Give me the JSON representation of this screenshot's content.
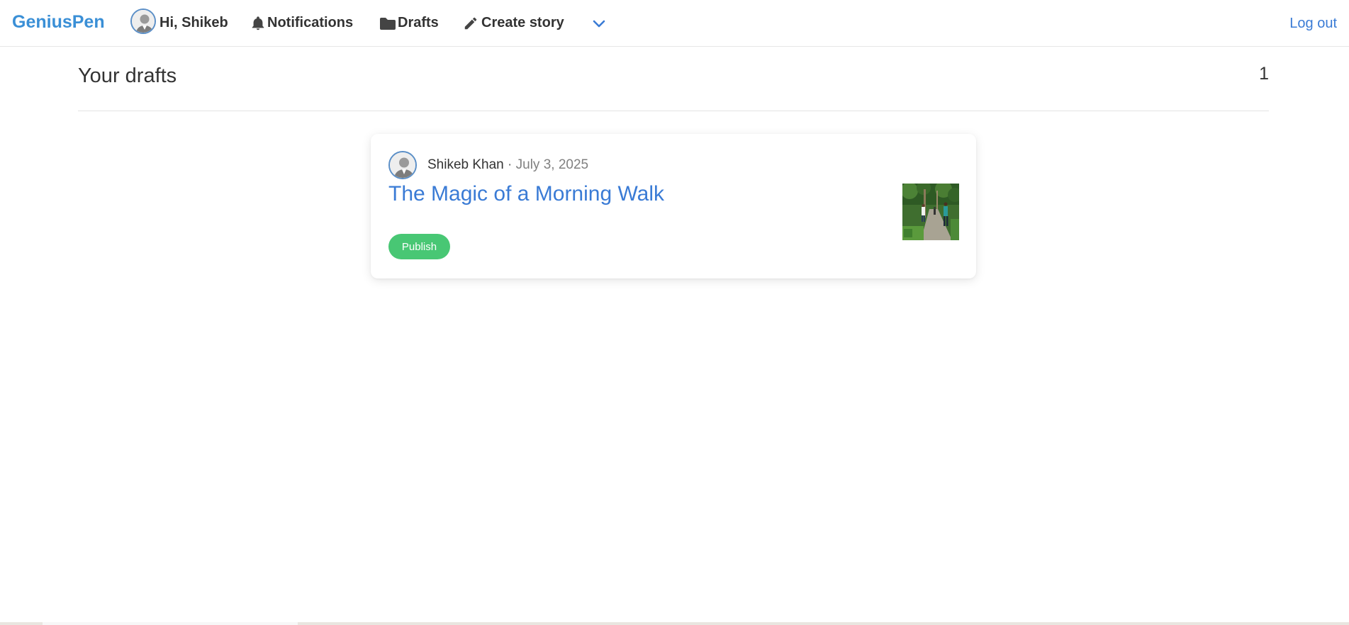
{
  "navbar": {
    "brand": "GeniusPen",
    "greeting": "Hi, Shikeb",
    "notifications_label": "Notifications",
    "drafts_label": "Drafts",
    "create_story_label": "Create story",
    "logout_label": "Log out",
    "icons": {
      "avatar": "user-avatar-icon",
      "notifications": "bell-icon",
      "drafts": "folder-icon",
      "create_story": "pencil-icon",
      "menu": "chevron-down-icon"
    }
  },
  "page": {
    "title": "Your drafts",
    "count": "1"
  },
  "drafts": [
    {
      "author": "Shikeb Khan",
      "separator": "·",
      "date": "July 3, 2025",
      "title": "The Magic of a Morning Walk",
      "publish_label": "Publish"
    }
  ],
  "colors": {
    "brand": "#3a8fd6",
    "link": "#3a7bd5",
    "publish": "#48c774"
  }
}
